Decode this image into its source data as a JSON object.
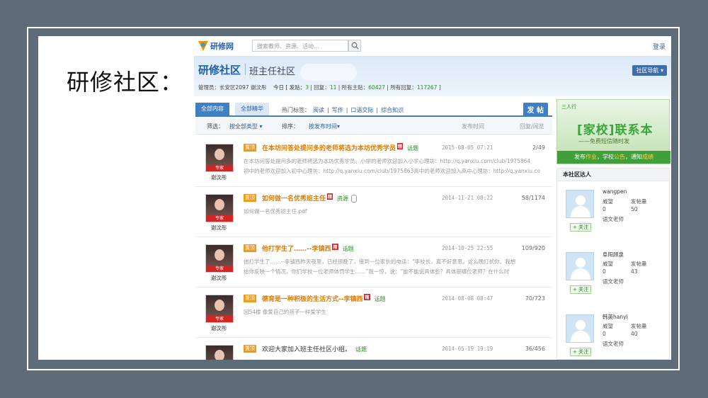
{
  "slide_title": "研修社区：",
  "topbar": {
    "logo_text": "研修网",
    "search_placeholder": "搜索教师、资源、活动...",
    "login_label": "登录"
  },
  "header": {
    "community_title": "研修社区",
    "sub_title": "班主任社区",
    "nav_button": "社区导航 ▾",
    "meta": {
      "admin_label": "管理员：",
      "admin_values": "长安区2097  谢汶彤",
      "today_label": "今日 [ 发贴：",
      "today_posts": "3",
      "replies_label": " | 回复：",
      "replies": "11",
      "topics_label": " | 所有主贴：",
      "topics": "60427",
      "all_replies_label": " | 所有回复：",
      "all_replies": "117267",
      "close": " ]"
    }
  },
  "tabs": {
    "all": "全部内容",
    "featured": "全部精华",
    "hot_label": "热门标签：",
    "hot_tags": [
      "阅读",
      "写作",
      "口语交际",
      "综合知识"
    ],
    "post_button": "发 帖"
  },
  "filter": {
    "filter_label": "筛选：",
    "filter_value": "按全部类型 ▾",
    "sort_label": "排序：",
    "sort_value": "按发布时间▾",
    "col_time": "发布时间",
    "col_reply": "回复/阅览"
  },
  "posts": [
    {
      "author": "谢汶彤",
      "avatar_tag": "专家",
      "badge": "置顶",
      "title": "在本坊问答处提问多的老师将选为本坊优秀学员",
      "jing": "精",
      "type": "话题",
      "date": "2015-08-05 07:21",
      "count": "2/49",
      "excerpt_lines": [
        "在本坊问答处提问多的老师将选为本坊优秀学员。小学的老师欢迎加入小学心理坊：http://q.yanxiu.com/club/1975864",
        "初中的老师欢迎加入初中心理坊：http://q.yanxiu.com/club/1975863高中的老师欢迎加入高中心理坊：http://q.yanxiu.co"
      ]
    },
    {
      "author": "谢汶彤",
      "avatar_tag": "专家",
      "badge": "置顶",
      "title": "如何做一名优秀班主任",
      "jing": "精",
      "type": "资源",
      "date": "2014-11-21 08:22",
      "count": "58/1174",
      "excerpt_lines": [
        "如何做一名优秀班主任.pdf"
      ]
    },
    {
      "author": "谢汶彤",
      "avatar_tag": "专家",
      "badge": "置顶",
      "title": "他打学生了……--李镇西",
      "jing": "精",
      "type": "话题",
      "date": "2014-10-25 22:55",
      "count": "109/920",
      "excerpt_lines": [
        "他打学生了……--李镇西昨天夜里，已经很晚了，接到一位家长的电话：“李校长，真不好意思，这么晚打扰你。我想",
        "给你反映一个情况，你们学校一位老师体罚学生……”我一惊，说：“能不能说具体些？具体是哪位老师？在什么时"
      ]
    },
    {
      "author": "谢汶彤",
      "avatar_tag": "专家",
      "badge": "置顶",
      "title": "德育是一种积极的生活方式--李镇西",
      "jing": "精",
      "type": "话题",
      "date": "2014-08-08 08:47",
      "count": "70/723",
      "excerpt_lines": [
        "回54楼 像爱自己的孩子一样爱学生"
      ]
    },
    {
      "author": "",
      "avatar_tag": "",
      "badge": "置顶",
      "title": "欢迎大家加入班主任社区小组。",
      "jing": "",
      "type": "话题",
      "date": "2014-05-19 19:19",
      "count": "36/456",
      "excerpt_lines": []
    }
  ],
  "ad": {
    "logo": "三人行",
    "main": "[家校]联系本",
    "sub": "——免费短信随时发",
    "bar_a": "发布",
    "bar_b": "作业",
    "bar_c": "，学校",
    "bar_d": "公告",
    "bar_e": "，通知",
    "bar_f": "成绩"
  },
  "experts": {
    "title": "本社区达人",
    "list": [
      {
        "name": "wangpen",
        "label_a": "威望",
        "label_b": "发帖量",
        "value_a": "0",
        "value_b": "50",
        "role": "语文老师",
        "follow": "+ 关注"
      },
      {
        "name": "阜阳顾泉",
        "label_a": "威望",
        "label_b": "发帖量",
        "value_a": "0",
        "value_b": "43",
        "role": "语文老师",
        "follow": "+ 关注"
      },
      {
        "name": "韩英hanyi",
        "label_a": "威望",
        "label_b": "发帖量",
        "value_a": "0",
        "value_b": "40",
        "role": "语文老师",
        "follow": "+ 关注"
      }
    ]
  }
}
